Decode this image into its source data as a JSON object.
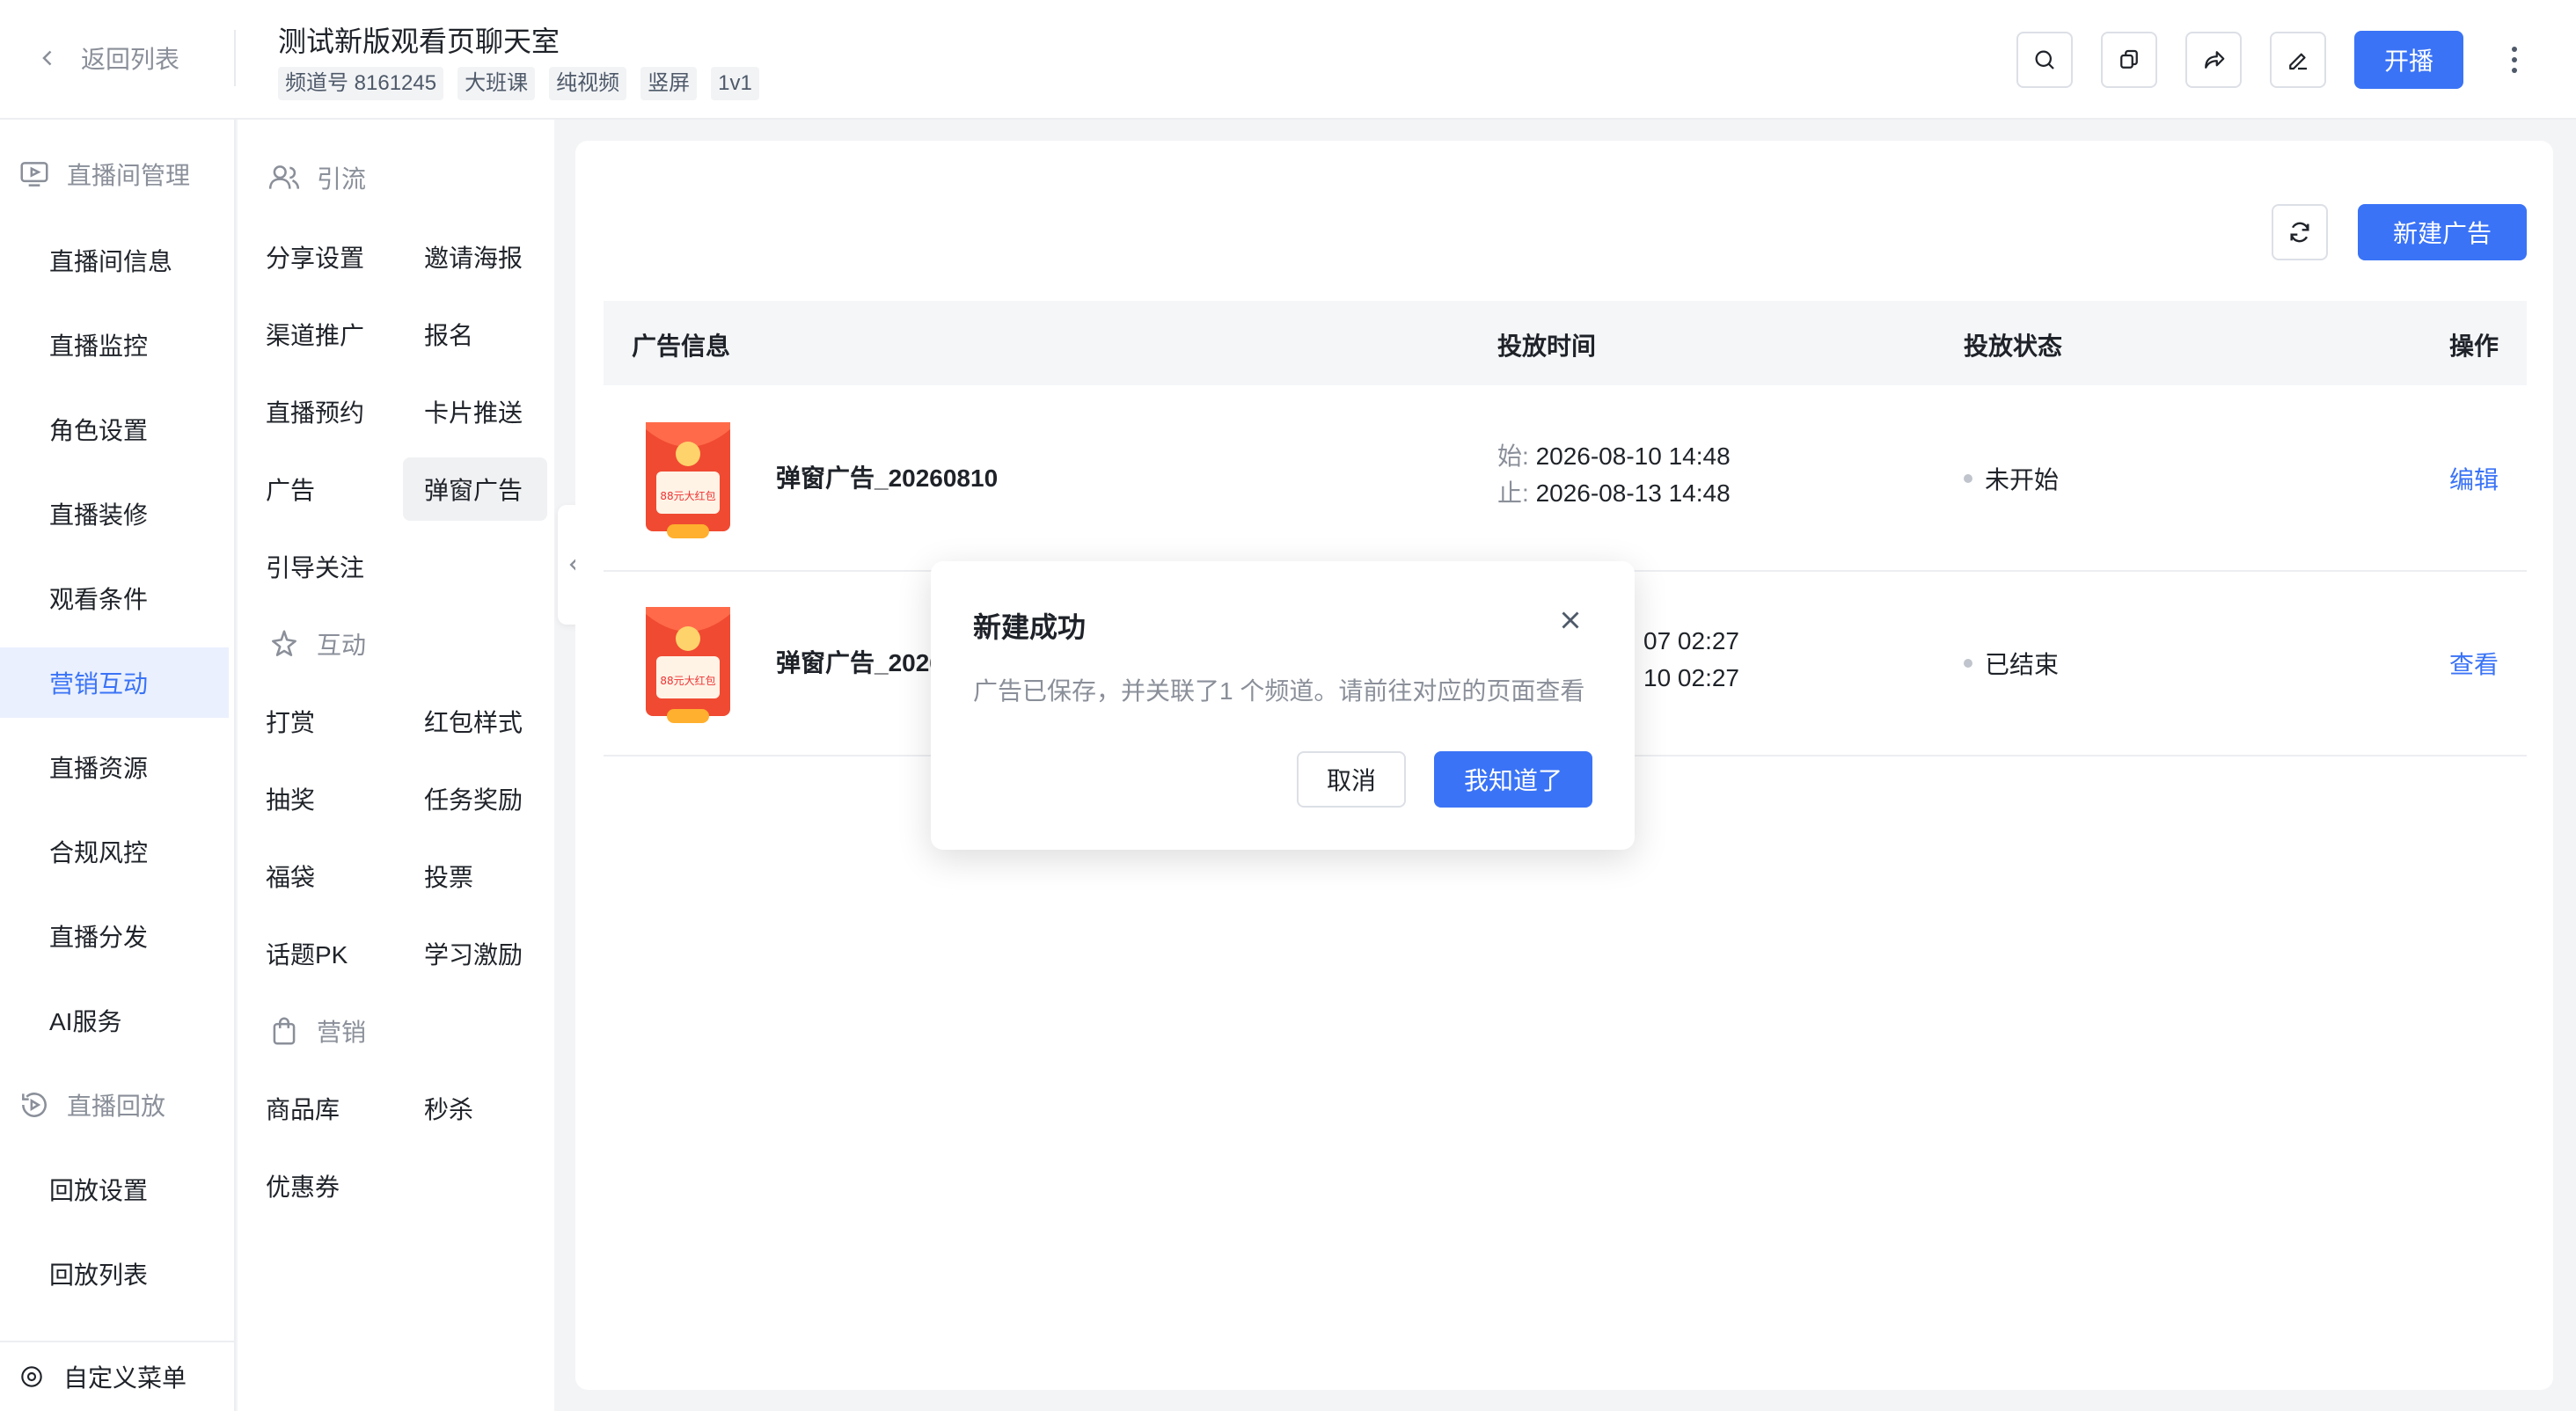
{
  "header": {
    "back_label": "返回列表",
    "title": "测试新版观看页聊天室",
    "tags": [
      "频道号 8161245",
      "大班课",
      "纯视频",
      "竖屏",
      "1v1"
    ],
    "start_label": "开播"
  },
  "nav1": {
    "group_live": "直播间管理",
    "items": [
      "直播间信息",
      "直播监控",
      "角色设置",
      "直播装修",
      "观看条件",
      "营销互动",
      "直播资源",
      "合规风控",
      "直播分发",
      "AI服务"
    ],
    "active": "营销互动",
    "group_replay": "直播回放",
    "replay_items": [
      "回放设置",
      "回放列表"
    ],
    "custom_menu": "自定义菜单"
  },
  "nav2": {
    "group_traffic": "引流",
    "traffic_items": [
      "分享设置",
      "邀请海报",
      "渠道推广",
      "报名",
      "直播预约",
      "卡片推送",
      "广告",
      "弹窗广告",
      "引导关注"
    ],
    "group_interact": "互动",
    "interact_items": [
      "打赏",
      "红包样式",
      "抽奖",
      "任务奖励",
      "福袋",
      "投票",
      "话题PK",
      "学习激励"
    ],
    "group_marketing": "营销",
    "marketing_items": [
      "商品库",
      "秒杀",
      "优惠券"
    ],
    "active": "弹窗广告"
  },
  "main": {
    "new_ad_label": "新建广告",
    "columns": [
      "广告信息",
      "投放时间",
      "投放状态",
      "操作"
    ],
    "start_prefix": "始:",
    "end_prefix": "止:",
    "thumb_text": "88元大红包",
    "rows": [
      {
        "name": "弹窗广告_20260810",
        "start": "2026-08-10 14:48",
        "end": "2026-08-13 14:48",
        "status": "未开始",
        "action": "编辑"
      },
      {
        "name": "弹窗广告_2026",
        "start": "07 02:27",
        "end": "10 02:27",
        "status": "已结束",
        "action": "查看"
      }
    ]
  },
  "modal": {
    "title": "新建成功",
    "body": "广告已保存，并关联了1 个频道。请前往对应的页面查看",
    "cancel": "取消",
    "ok": "我知道了"
  },
  "colors": {
    "accent": "#3a73f6",
    "active_bg": "#eaf0fe",
    "muted": "#8a8f99",
    "text": "#1f2329"
  }
}
